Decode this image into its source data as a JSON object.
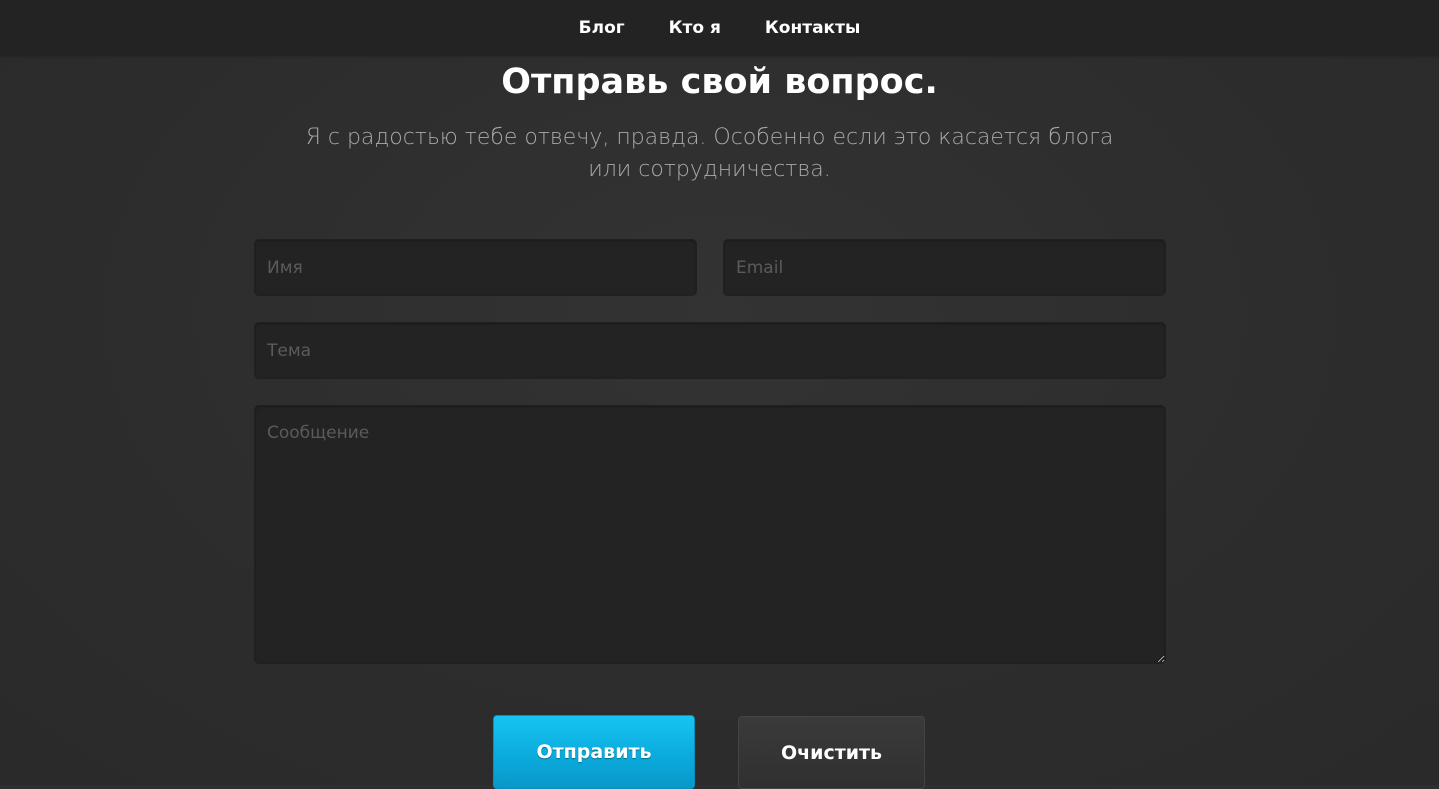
{
  "nav": {
    "items": [
      {
        "label": "Блог"
      },
      {
        "label": "Кто я"
      },
      {
        "label": "Контакты"
      }
    ]
  },
  "contact": {
    "title": "Отправь свой вопрос.",
    "subtitle": "Я с радостью тебе отвечу, правда. Особенно если это касается блога или сотрудничества."
  },
  "form": {
    "name_placeholder": "Имя",
    "email_placeholder": "Email",
    "subject_placeholder": "Тема",
    "message_placeholder": "Сообщение",
    "name_value": "",
    "email_value": "",
    "subject_value": "",
    "message_value": ""
  },
  "buttons": {
    "send_label": "Отправить",
    "clear_label": "Очистить"
  },
  "colors": {
    "accent": "#0aa9db",
    "background": "#2e2e2e",
    "navbar": "#232323"
  }
}
